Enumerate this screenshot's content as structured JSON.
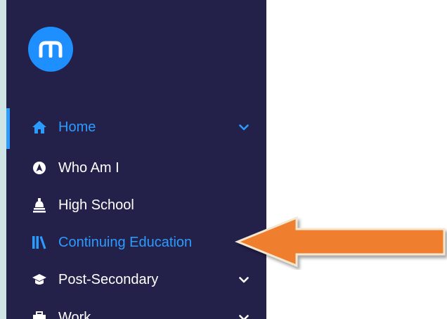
{
  "sidebar": {
    "logo_icon": "logo-m-icon",
    "items": [
      {
        "label": "Home",
        "icon": "home-icon",
        "has_chevron": true,
        "state": "active"
      },
      {
        "label": "Who Am I",
        "icon": "compass-icon",
        "has_chevron": false
      },
      {
        "label": "High School",
        "icon": "school-bell-icon",
        "has_chevron": false
      },
      {
        "label": "Continuing Education",
        "icon": "books-icon",
        "has_chevron": false,
        "state": "highlighted"
      },
      {
        "label": "Post-Secondary",
        "icon": "graduation-cap-icon",
        "has_chevron": true
      },
      {
        "label": "Work",
        "icon": "briefcase-icon",
        "has_chevron": true
      }
    ]
  },
  "annotation": {
    "type": "arrow",
    "points_to": "Continuing Education",
    "color": "#ef7f2f"
  },
  "colors": {
    "sidebar_bg": "#23214a",
    "accent_blue": "#2c9bff",
    "logo_blue": "#1e8fff",
    "text_white": "#ffffff",
    "arrow_orange": "#ef7f2f"
  }
}
